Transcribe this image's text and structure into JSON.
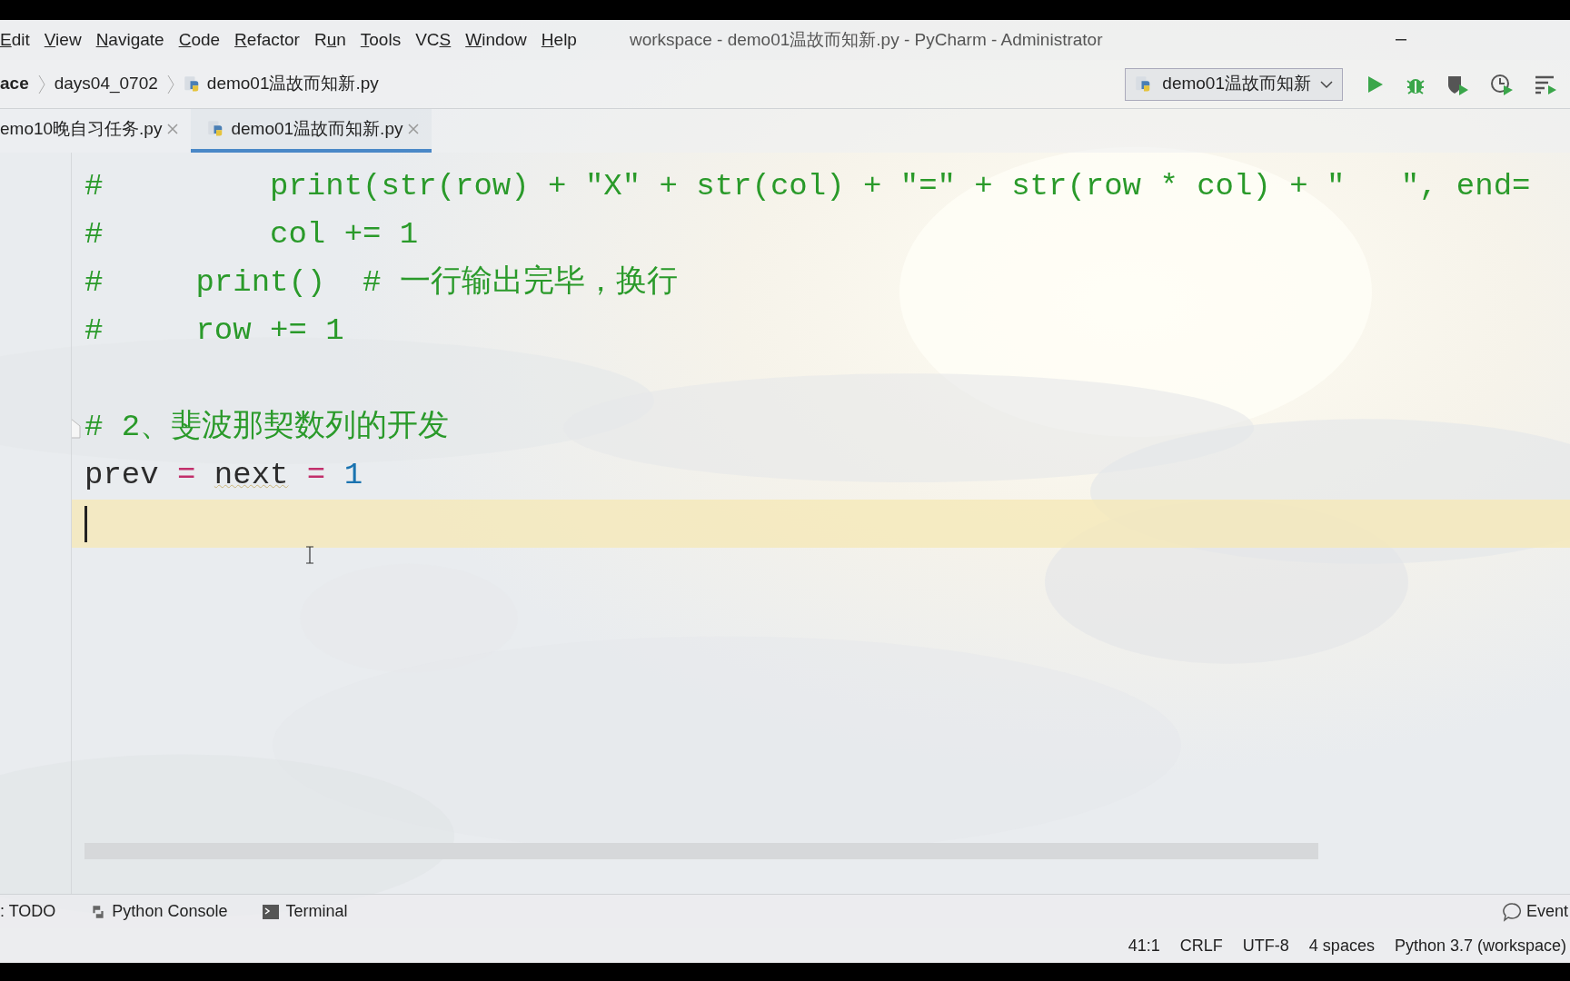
{
  "menu": [
    [
      {
        "text": "E",
        "underlined": true
      },
      {
        "text": "dit",
        "underlined": false
      }
    ],
    [
      {
        "text": "V",
        "underlined": true
      },
      {
        "text": "iew",
        "underlined": false
      }
    ],
    [
      {
        "text": "N",
        "underlined": true
      },
      {
        "text": "avigate",
        "underlined": false
      }
    ],
    [
      {
        "text": "C",
        "underlined": true
      },
      {
        "text": "ode",
        "underlined": false
      }
    ],
    [
      {
        "text": "R",
        "underlined": true
      },
      {
        "text": "efactor",
        "underlined": false
      }
    ],
    [
      {
        "text": "R",
        "underlined": false
      },
      {
        "text": "u",
        "underlined": true
      },
      {
        "text": "n",
        "underlined": false
      }
    ],
    [
      {
        "text": "T",
        "underlined": true
      },
      {
        "text": "ools",
        "underlined": false
      }
    ],
    [
      {
        "text": "VC",
        "underlined": false
      },
      {
        "text": "S",
        "underlined": true
      }
    ],
    [
      {
        "text": "W",
        "underlined": true
      },
      {
        "text": "indow",
        "underlined": false
      }
    ],
    [
      {
        "text": "H",
        "underlined": true
      },
      {
        "text": "elp",
        "underlined": false
      }
    ]
  ],
  "window": {
    "title": "workspace - demo01温故而知新.py - PyCharm - Administrator"
  },
  "breadcrumbs": [
    {
      "label": "ace",
      "kind": "folder"
    },
    {
      "label": "days04_0702",
      "kind": "folder"
    },
    {
      "label": "demo01温故而知新.py",
      "kind": "file"
    }
  ],
  "run_config": {
    "label": "demo01温故而知新"
  },
  "tabs": [
    {
      "label": "emo10晚自习任务.py",
      "selected": false
    },
    {
      "label": "demo01温故而知新.py",
      "selected": true
    }
  ],
  "editor": {
    "lines": [
      {
        "current": false,
        "fold_marker": false,
        "tokens": [
          {
            "kind": "comment",
            "text": "#         print(str(row) + \"X\" + str(col) + \"=\" + str(row * col) + \"   \", end="
          }
        ]
      },
      {
        "current": false,
        "fold_marker": false,
        "tokens": [
          {
            "kind": "comment",
            "text": "#         col += 1"
          }
        ]
      },
      {
        "current": false,
        "fold_marker": false,
        "tokens": [
          {
            "kind": "comment",
            "text": "#     print()  # 一行输出完毕，换行"
          }
        ]
      },
      {
        "current": false,
        "fold_marker": false,
        "tokens": [
          {
            "kind": "comment",
            "text": "#     row += 1"
          }
        ]
      },
      {
        "current": false,
        "fold_marker": false
      },
      {
        "current": false,
        "fold_marker": true,
        "tokens": [
          {
            "kind": "comment",
            "text": "# 2、斐波那契数列的开发"
          }
        ]
      },
      {
        "current": false,
        "fold_marker": false,
        "tokens": [
          {
            "kind": "plain",
            "text": "prev ",
            "squiggly": false
          },
          {
            "kind": "operator",
            "text": "= ",
            "squiggly": false
          },
          {
            "kind": "plain",
            "text": "next",
            "squiggly": true
          },
          {
            "kind": "operator",
            "text": " = ",
            "squiggly": false
          },
          {
            "kind": "number",
            "text": "1",
            "squiggly": false
          }
        ]
      },
      {
        "current": true,
        "fold_marker": false
      }
    ]
  },
  "tool_windows": [
    {
      "label": ": TODO",
      "kind": "todo"
    },
    {
      "label": "Python Console",
      "kind": "python"
    },
    {
      "label": "Terminal",
      "kind": "terminal"
    }
  ],
  "event_log": {
    "label": "Event"
  },
  "status_bar": [
    "41:1",
    "CRLF",
    "UTF-8",
    "4 spaces",
    "Python 3.7 (workspace)"
  ]
}
